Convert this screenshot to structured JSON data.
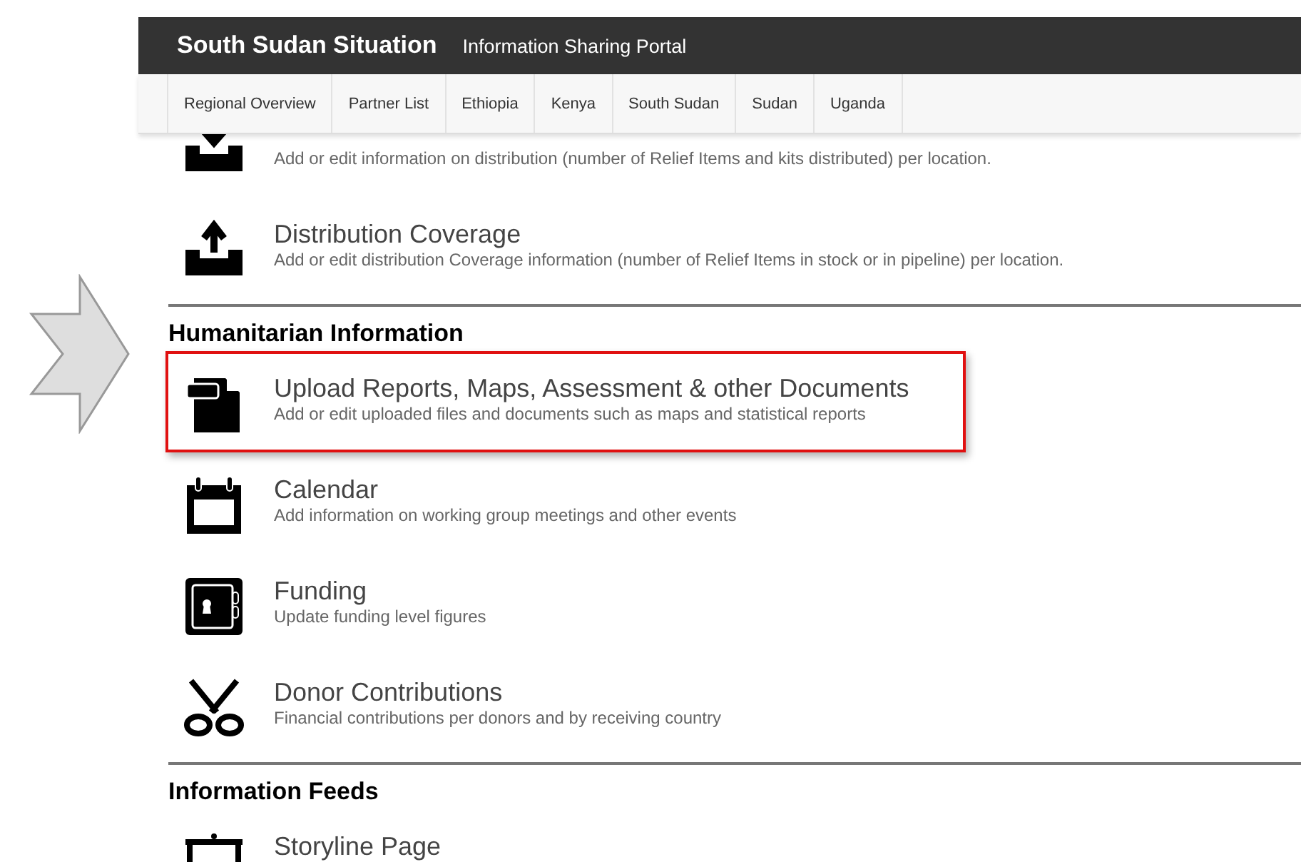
{
  "header": {
    "title": "South Sudan Situation",
    "subtitle": "Information Sharing Portal"
  },
  "nav": [
    {
      "label": "Regional Overview"
    },
    {
      "label": "Partner List"
    },
    {
      "label": "Ethiopia"
    },
    {
      "label": "Kenya"
    },
    {
      "label": "South Sudan"
    },
    {
      "label": "Sudan"
    },
    {
      "label": "Uganda"
    }
  ],
  "sections": [
    {
      "items": [
        {
          "kind": "tray-in",
          "description": "Add or edit information on distribution (number of Relief Items and kits distributed) per location.",
          "highlighted": false
        },
        {
          "kind": "tray-out",
          "title": "Distribution Coverage",
          "description": "Add or edit distribution Coverage information (number of Relief Items in stock or in pipeline) per location.",
          "highlighted": false
        }
      ]
    },
    {
      "heading": "Humanitarian Information",
      "items": [
        {
          "kind": "documents",
          "title": "Upload Reports, Maps, Assessment & other Documents",
          "description": "Add or edit uploaded files and documents such as maps and statistical reports",
          "highlighted": true
        },
        {
          "kind": "calendar",
          "title": "Calendar",
          "description": "Add information on working group meetings and other events",
          "highlighted": false
        },
        {
          "kind": "safe",
          "title": "Funding",
          "description": "Update funding level figures",
          "highlighted": false
        },
        {
          "kind": "scissors",
          "title": "Donor Contributions",
          "description": "Financial contributions per donors and by receiving country",
          "highlighted": false
        }
      ]
    },
    {
      "heading": "Information Feeds",
      "items": [
        {
          "kind": "easel",
          "title": "Storyline Page",
          "highlighted": false
        }
      ]
    }
  ]
}
